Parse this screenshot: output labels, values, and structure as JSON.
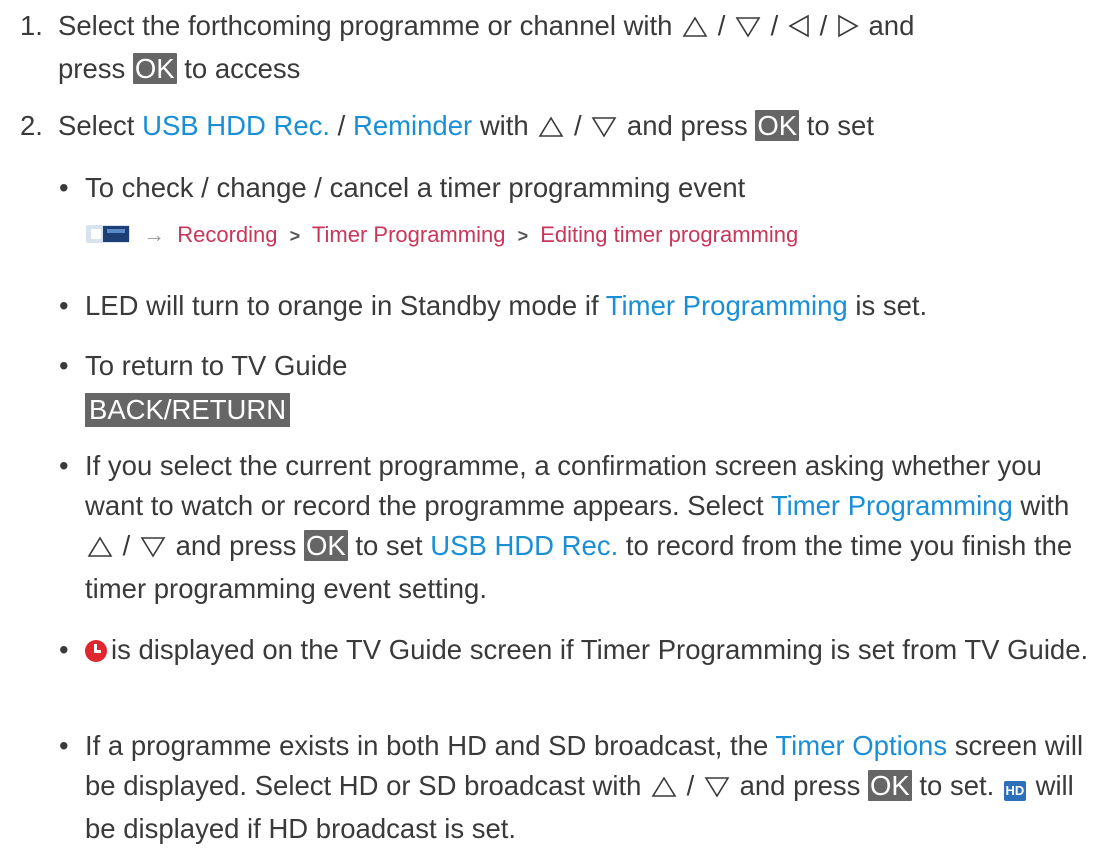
{
  "step1": {
    "num": "1.",
    "text_a": "Select the forthcoming programme or channel with",
    "text_b": "and",
    "line2_a": "press",
    "key_ok": "OK",
    "line2_b": "to access"
  },
  "step2": {
    "num": "2.",
    "text_a": "Select",
    "usb": "USB HDD Rec.",
    "slash": "/",
    "reminder": "Reminder",
    "text_b": "with",
    "text_c": "and press",
    "key_ok": "OK",
    "text_d": "to set"
  },
  "bullet1": "To check / change / cancel a timer programming event",
  "path": {
    "arrow": "→",
    "item1": "Recording",
    "sep": ">",
    "item2": "Timer Programming",
    "item3": "Editing timer programming"
  },
  "bullet2": {
    "a": "LED will turn to orange in Standby mode if",
    "link": "Timer Programming",
    "b": "is set."
  },
  "bullet3": "To return to TV Guide",
  "back_key": "BACK/RETURN",
  "bullet4": {
    "a": "If you select the current programme, a confirmation screen asking whether you want to watch or record the programme appears. Select",
    "link1": "Timer Programming",
    "b": "with",
    "c": "and press",
    "key_ok": "OK",
    "d": "to set",
    "link2": "USB HDD Rec.",
    "e": "to record from the time you finish the timer programming event setting."
  },
  "bullet5": {
    "text": "is displayed on the TV Guide screen if Timer Programming is set from TV Guide."
  },
  "bullet6": {
    "a": "If a programme exists in both HD and SD broadcast, the",
    "link": "Timer Options",
    "b": "screen will be displayed. Select HD or SD broadcast with",
    "c": "and press",
    "key_ok": "OK",
    "d": "to set.",
    "hd_label": "HD",
    "e": "will be displayed if HD broadcast is set."
  },
  "icons": [
    "up-triangle-icon",
    "down-triangle-icon",
    "left-triangle-icon",
    "right-triangle-icon",
    "tv-guide-icon",
    "timer-clock-icon",
    "hd-icon"
  ],
  "colors": {
    "link": "#1a8fd6",
    "path": "#c8365a",
    "key_bg": "#666666",
    "clock": "#e0262f",
    "hd": "#2d6fb8"
  }
}
